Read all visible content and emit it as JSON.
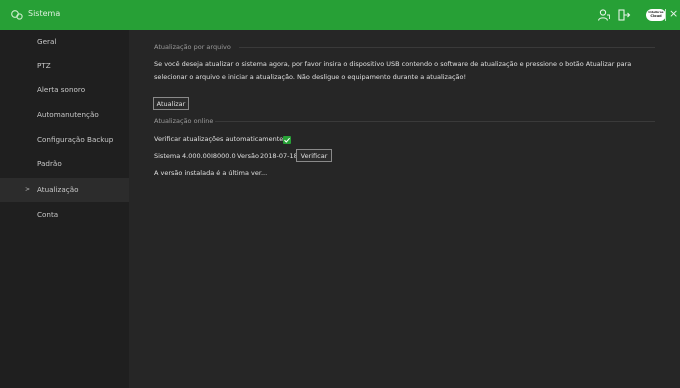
{
  "titlebar": {
    "title": "Sistema",
    "cloud_badge_line1": "Intelbras",
    "cloud_badge_line2": "Cloud",
    "close_symbol": "×"
  },
  "sidebar": {
    "items": [
      {
        "label": "Geral"
      },
      {
        "label": "PTZ"
      },
      {
        "label": "Alerta sonoro"
      },
      {
        "label": "Automanutenção"
      },
      {
        "label": "Configuração Backup"
      },
      {
        "label": "Padrão"
      },
      {
        "label": "Atualização",
        "active": true
      },
      {
        "label": "Conta"
      }
    ],
    "active_arrow": ">"
  },
  "main": {
    "file_update": {
      "title": "Atualização por arquivo",
      "description_line1": "Se você deseja atualizar o sistema agora, por favor insira o dispositivo USB contendo o software de atualização e pressione o botão Atualizar para",
      "description_line2": "selecionar o arquivo e iniciar a atualização. Não desligue o equipamento durante a atualização!",
      "update_button": "Atualizar"
    },
    "online_update": {
      "title": "Atualização online",
      "auto_check_label": "Verificar atualizações automaticamente.",
      "auto_check_checked": true,
      "system_label": "Sistema",
      "system_value": "4.000.00I8000.0",
      "version_label": "Versão",
      "version_value": "2018-07-18",
      "check_button": "Verificar",
      "status": "A versão instalada é a última ver..."
    }
  },
  "colors": {
    "accent": "#27a036",
    "background": "#262626",
    "sidebar": "#1f1f1f"
  },
  "icons": [
    "app-logo-icon",
    "user-icon",
    "logout-icon",
    "cloud-icon",
    "close-icon",
    "checkmark-icon"
  ]
}
